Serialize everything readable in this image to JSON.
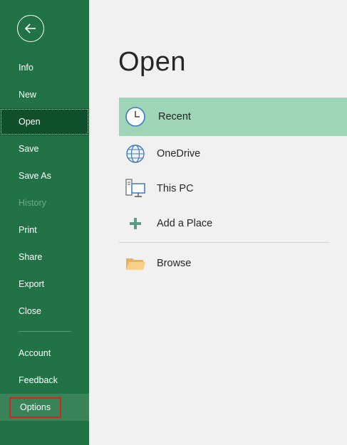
{
  "sidebar": {
    "back_icon": "back-arrow-icon",
    "items": [
      {
        "label": "Info"
      },
      {
        "label": "New"
      },
      {
        "label": "Open"
      },
      {
        "label": "Save"
      },
      {
        "label": "Save As"
      },
      {
        "label": "History"
      },
      {
        "label": "Print"
      },
      {
        "label": "Share"
      },
      {
        "label": "Export"
      },
      {
        "label": "Close"
      }
    ],
    "bottom_items": [
      {
        "label": "Account"
      },
      {
        "label": "Feedback"
      },
      {
        "label": "Options"
      }
    ]
  },
  "main": {
    "title": "Open",
    "places": [
      {
        "label": "Recent",
        "icon": "clock-icon"
      },
      {
        "label": "OneDrive",
        "icon": "globe-icon"
      },
      {
        "label": "This PC",
        "icon": "computer-icon"
      },
      {
        "label": "Add a Place",
        "icon": "plus-icon"
      },
      {
        "label": "Browse",
        "icon": "folder-icon"
      }
    ]
  },
  "colors": {
    "sidebar_bg": "#217346",
    "active_item_bg": "#0f4f2a",
    "selected_place_bg": "#9fd5b7",
    "highlight_box": "#d3231d"
  }
}
